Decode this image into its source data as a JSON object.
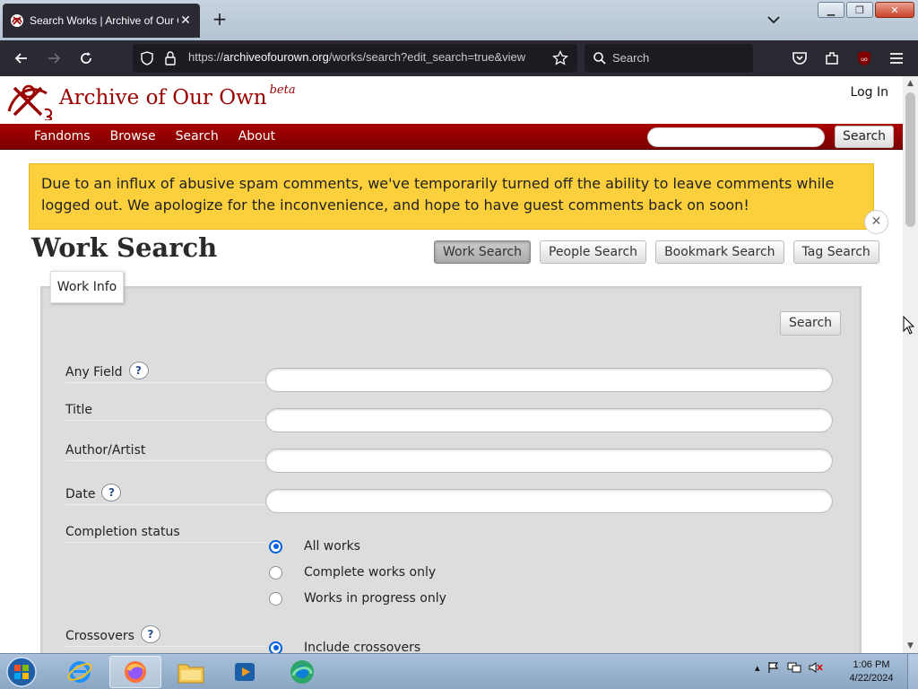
{
  "browser": {
    "tab_title": "Search Works | Archive of Our Own",
    "url_scheme": "https://",
    "url_host": "archiveofourown.org",
    "url_path": "/works/search?edit_search=true&view",
    "search_placeholder": "Search"
  },
  "site": {
    "name": "Archive of Our Own",
    "beta": "beta",
    "login": "Log In",
    "brand_color": "#990000"
  },
  "primary_nav": {
    "items": [
      "Fandoms",
      "Browse",
      "Search",
      "About"
    ],
    "search_button": "Search"
  },
  "notice": {
    "text": "Due to an influx of abusive spam comments, we've temporarily turned off the ability to leave comments while logged out. We apologize for the inconvenience, and hope to have guest comments back on soon!",
    "color": "#fccf3d"
  },
  "page": {
    "heading": "Work Search",
    "subnav": [
      "Work Search",
      "People Search",
      "Bookmark Search",
      "Tag Search"
    ],
    "subnav_current": "Work Search"
  },
  "form": {
    "legend": "Work Info",
    "search_button": "Search",
    "help_glyph": "?",
    "fields": {
      "any_field": "Any Field",
      "title": "Title",
      "author": "Author/Artist",
      "date": "Date",
      "completion": "Completion status",
      "crossovers": "Crossovers"
    },
    "completion_options": [
      "All works",
      "Complete works only",
      "Works in progress only"
    ],
    "completion_selected": "All works",
    "crossover_options": [
      "Include crossovers"
    ],
    "crossover_selected": "Include crossovers"
  },
  "taskbar": {
    "time": "1:06 PM",
    "date": "4/22/2024",
    "apps": [
      "internet-explorer-icon",
      "firefox-icon",
      "file-explorer-icon",
      "media-player-icon",
      "edge-icon"
    ]
  }
}
